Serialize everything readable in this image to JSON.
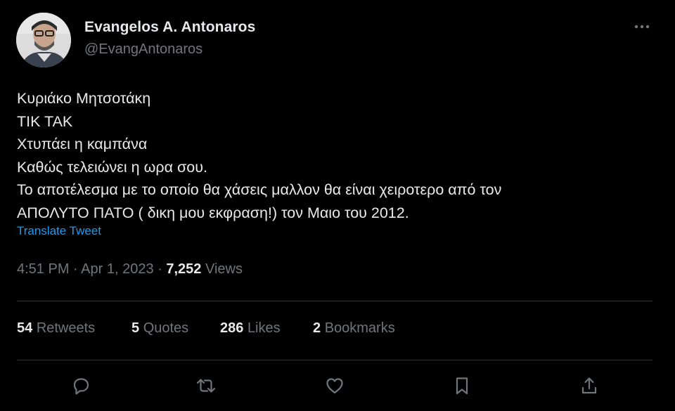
{
  "author": {
    "name": "Evangelos A. Antonaros",
    "handle": "@EvangAntonaros"
  },
  "tweet": {
    "lines": [
      "Κυριάκο Μητσοτάκη",
      "ΤΙΚ ΤΑΚ",
      "Χτυπάει η καμπάνα",
      "Καθώς τελειώνει η ωρα σου.",
      "Το αποτέλεσμα με το οποίο θα χάσεις μαλλον θα είναι χειροτερο από τον",
      "ΑΠΟΛΥΤΟ ΠΑΤΟ ( δικη μου εκφραση!) τον Μαιο του 2012."
    ],
    "translate_label": "Translate Tweet"
  },
  "meta": {
    "time": "4:51 PM",
    "date": "Apr 1, 2023",
    "separator": " · ",
    "views_count": "7,252",
    "views_label": "Views"
  },
  "stats": {
    "retweets": {
      "count": "54",
      "label": "Retweets"
    },
    "quotes": {
      "count": "5",
      "label": "Quotes"
    },
    "likes": {
      "count": "286",
      "label": "Likes"
    },
    "bookmarks": {
      "count": "2",
      "label": "Bookmarks"
    }
  },
  "icons": {
    "more": "more-dots-icon",
    "reply": "reply-icon",
    "retweet": "retweet-icon",
    "like": "heart-icon",
    "bookmark": "bookmark-icon",
    "share": "share-icon"
  },
  "colors": {
    "background": "#000000",
    "text_primary": "#e7e9ea",
    "text_secondary": "#71767b",
    "link": "#1d9bf0",
    "divider": "#2f3336"
  }
}
